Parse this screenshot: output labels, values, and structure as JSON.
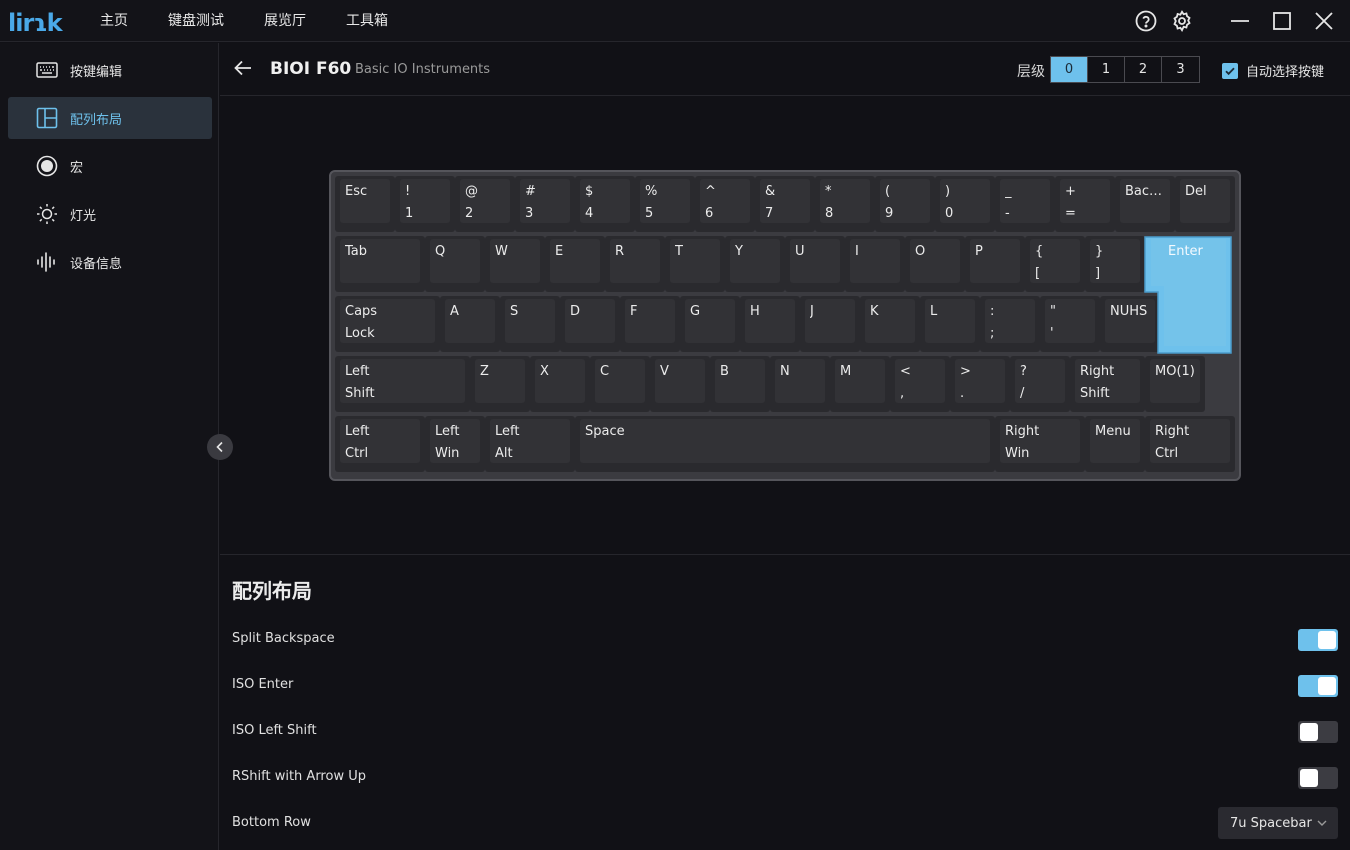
{
  "app": {
    "logo_text": "lirɿk"
  },
  "topnav": [
    "主页",
    "键盘测试",
    "展览厅",
    "工具箱"
  ],
  "sidebar": {
    "items": [
      {
        "label": "按键编辑",
        "icon": "keyboard-icon"
      },
      {
        "label": "配列布局",
        "icon": "layout-icon",
        "active": true
      },
      {
        "label": "宏",
        "icon": "record-icon"
      },
      {
        "label": "灯光",
        "icon": "sun-icon"
      },
      {
        "label": "设备信息",
        "icon": "waveform-icon"
      }
    ]
  },
  "header": {
    "name": "BIOI F60",
    "vendor": "Basic IO Instruments",
    "layer_label": "层级",
    "layers": [
      "0",
      "1",
      "2",
      "3"
    ],
    "active_layer": "0",
    "auto_select_label": "自动选择按键",
    "auto_select_checked": true
  },
  "keys": [
    {
      "l1": "Esc",
      "l2": ""
    },
    {
      "l1": "!",
      "l2": "1"
    },
    {
      "l1": "@",
      "l2": "2"
    },
    {
      "l1": "#",
      "l2": "3"
    },
    {
      "l1": "$",
      "l2": "4"
    },
    {
      "l1": "%",
      "l2": "5"
    },
    {
      "l1": "^",
      "l2": "6"
    },
    {
      "l1": "&",
      "l2": "7"
    },
    {
      "l1": "*",
      "l2": "8"
    },
    {
      "l1": "(",
      "l2": "9"
    },
    {
      "l1": ")",
      "l2": "0"
    },
    {
      "l1": "_",
      "l2": "-"
    },
    {
      "l1": "+",
      "l2": "="
    },
    {
      "l1": "Backs...",
      "l2": ""
    },
    {
      "l1": "Del",
      "l2": ""
    },
    {
      "l1": "Tab",
      "l2": ""
    },
    {
      "l1": "Q",
      "l2": ""
    },
    {
      "l1": "W",
      "l2": ""
    },
    {
      "l1": "E",
      "l2": ""
    },
    {
      "l1": "R",
      "l2": ""
    },
    {
      "l1": "T",
      "l2": ""
    },
    {
      "l1": "Y",
      "l2": ""
    },
    {
      "l1": "U",
      "l2": ""
    },
    {
      "l1": "I",
      "l2": ""
    },
    {
      "l1": "O",
      "l2": ""
    },
    {
      "l1": "P",
      "l2": ""
    },
    {
      "l1": "{",
      "l2": "["
    },
    {
      "l1": "}",
      "l2": "]"
    },
    {
      "l1": "Caps",
      "l2": "Lock"
    },
    {
      "l1": "A",
      "l2": ""
    },
    {
      "l1": "S",
      "l2": ""
    },
    {
      "l1": "D",
      "l2": ""
    },
    {
      "l1": "F",
      "l2": ""
    },
    {
      "l1": "G",
      "l2": ""
    },
    {
      "l1": "H",
      "l2": ""
    },
    {
      "l1": "J",
      "l2": ""
    },
    {
      "l1": "K",
      "l2": ""
    },
    {
      "l1": "L",
      "l2": ""
    },
    {
      "l1": ":",
      "l2": ";"
    },
    {
      "l1": "\"",
      "l2": "'"
    },
    {
      "l1": "NUHS",
      "l2": ""
    },
    {
      "l1": "Left",
      "l2": "Shift"
    },
    {
      "l1": "Z",
      "l2": ""
    },
    {
      "l1": "X",
      "l2": ""
    },
    {
      "l1": "C",
      "l2": ""
    },
    {
      "l1": "V",
      "l2": ""
    },
    {
      "l1": "B",
      "l2": ""
    },
    {
      "l1": "N",
      "l2": ""
    },
    {
      "l1": "M",
      "l2": ""
    },
    {
      "l1": "<",
      "l2": ","
    },
    {
      "l1": ">",
      "l2": "."
    },
    {
      "l1": "?",
      "l2": "/"
    },
    {
      "l1": "Right",
      "l2": "Shift"
    },
    {
      "l1": "MO(1)",
      "l2": ""
    },
    {
      "l1": "Left",
      "l2": "Ctrl"
    },
    {
      "l1": "Left",
      "l2": "Win"
    },
    {
      "l1": "Left",
      "l2": "Alt"
    },
    {
      "l1": "Space",
      "l2": ""
    },
    {
      "l1": "Right",
      "l2": "Win"
    },
    {
      "l1": "Menu",
      "l2": ""
    },
    {
      "l1": "Right",
      "l2": "Ctrl"
    }
  ],
  "enter_key": {
    "label": "Enter",
    "selected": true
  },
  "settings": {
    "title": "配列布局",
    "toggles": [
      {
        "label": "Split Backspace",
        "on": true
      },
      {
        "label": "ISO Enter",
        "on": true
      },
      {
        "label": "ISO Left Shift",
        "on": false
      },
      {
        "label": "RShift with Arrow Up",
        "on": false
      }
    ],
    "bottom_row": {
      "label": "Bottom Row",
      "value": "7u Spacebar"
    }
  },
  "colors": {
    "accent": "#6ec1ec",
    "background": "#111116",
    "keycap": "#323236"
  }
}
